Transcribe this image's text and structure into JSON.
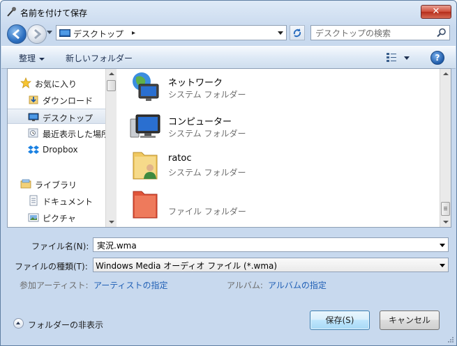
{
  "window": {
    "title": "名前を付けて保存",
    "close_label": "✕"
  },
  "nav": {
    "address": "デスクトップ",
    "address_separator": "▸",
    "search_placeholder": "デスクトップの検索"
  },
  "toolbar": {
    "organize": "整理",
    "new_folder": "新しいフォルダー",
    "help": "?"
  },
  "sidebar": {
    "items": [
      {
        "label": "お気に入り",
        "icon": "star-icon"
      },
      {
        "label": "ダウンロード",
        "icon": "download-folder-icon"
      },
      {
        "label": "デスクトップ",
        "icon": "desktop-icon",
        "selected": true
      },
      {
        "label": "最近表示した場所",
        "icon": "recent-places-icon"
      },
      {
        "label": "Dropbox",
        "icon": "dropbox-icon"
      },
      {
        "label": "ライブラリ",
        "icon": "library-icon"
      },
      {
        "label": "ドキュメント",
        "icon": "document-icon"
      },
      {
        "label": "ピクチャ",
        "icon": "pictures-icon"
      }
    ]
  },
  "files": [
    {
      "name": "ネットワーク",
      "type": "システム フォルダー",
      "icon": "network-icon"
    },
    {
      "name": "コンピューター",
      "type": "システム フォルダー",
      "icon": "computer-icon"
    },
    {
      "name": "ratoc",
      "type": "システム フォルダー",
      "icon": "user-folder-icon"
    },
    {
      "name": "",
      "type": "ファイル フォルダー",
      "icon": "red-folder-icon"
    }
  ],
  "form": {
    "filename_label": "ファイル名(N):",
    "filename_value": "実況.wma",
    "filetype_label": "ファイルの種類(T):",
    "filetype_value": "Windows Media オーディオ ファイル (*.wma)",
    "artist_label": "参加アーティスト:",
    "artist_link": "アーティストの指定",
    "album_label": "アルバム:",
    "album_link": "アルバムの指定"
  },
  "footer": {
    "hide_folders": "フォルダーの非表示",
    "save_button": "保存(S)",
    "cancel_button": "キャンセル"
  }
}
